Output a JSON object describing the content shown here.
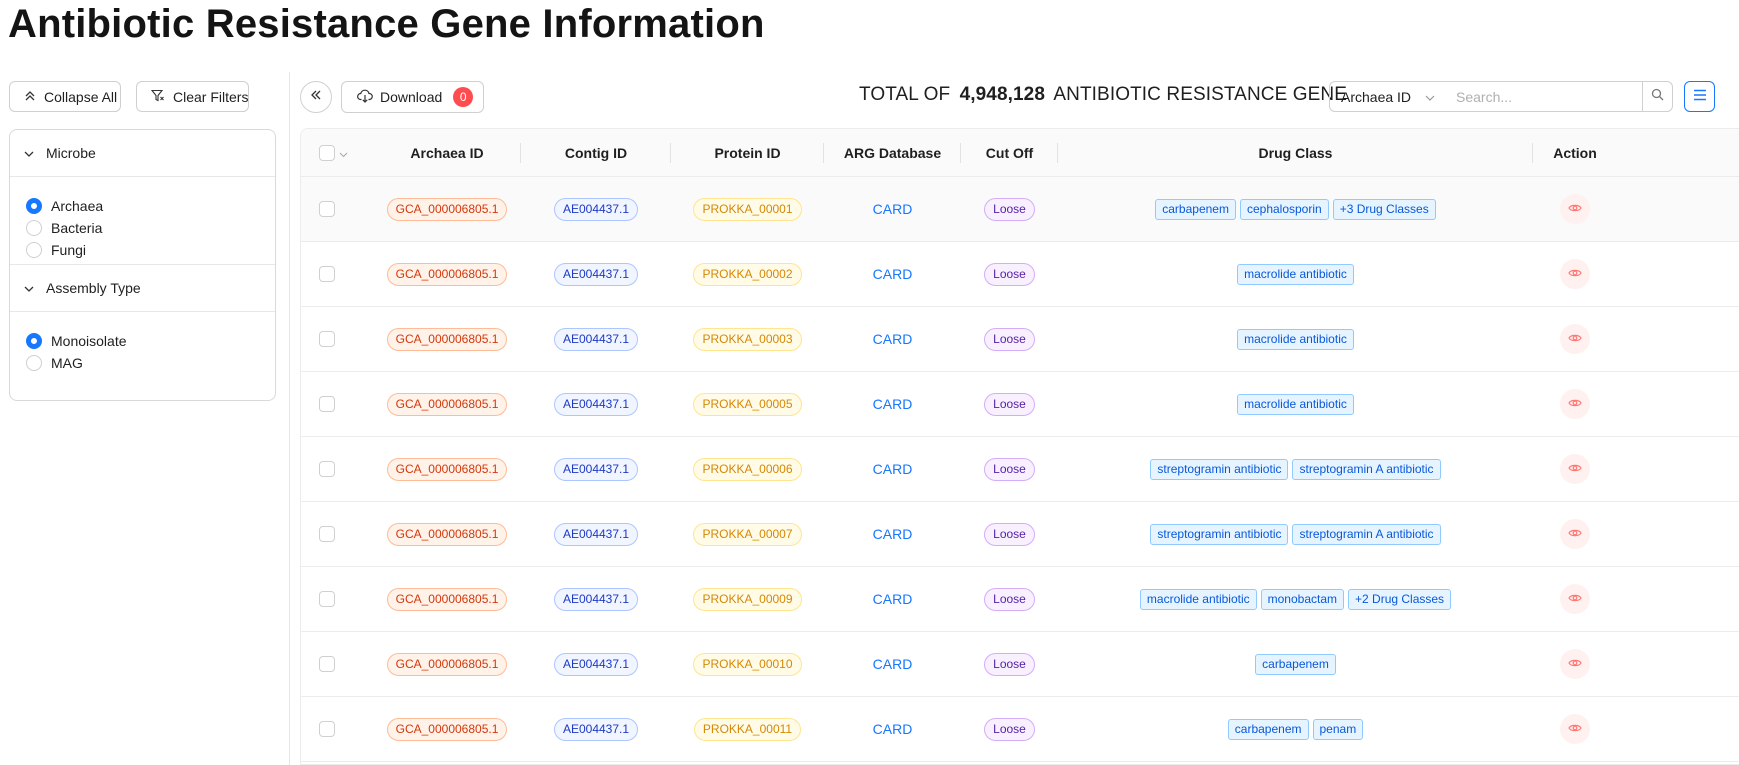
{
  "page": {
    "title": "Antibiotic Resistance Gene Information"
  },
  "left_panel": {
    "collapse_all_label": "Collapse All",
    "clear_filters_label": "Clear Filters",
    "sections": {
      "microbe": {
        "title": "Microbe",
        "options": [
          "Archaea",
          "Bacteria",
          "Fungi"
        ],
        "selected": "Archaea"
      },
      "assembly_type": {
        "title": "Assembly Type",
        "options": [
          "Monoisolate",
          "MAG"
        ],
        "selected": "Monoisolate"
      }
    }
  },
  "toolbar": {
    "download_label": "Download",
    "download_count": "0",
    "total_prefix": "TOTAL OF",
    "total_count": "4,948,128",
    "total_suffix": "ANTIBIOTIC RESISTANCE GENE",
    "search_field": "Archaea ID",
    "search_placeholder": "Search..."
  },
  "table": {
    "headers": {
      "archaea_id": "Archaea ID",
      "contig_id": "Contig ID",
      "protein_id": "Protein ID",
      "arg_database": "ARG Database",
      "cut_off": "Cut Off",
      "drug_class": "Drug Class",
      "action": "Action"
    },
    "rows": [
      {
        "archaea_id": "GCA_000006805.1",
        "contig_id": "AE004437.1",
        "protein_id": "PROKKA_00001",
        "db": "CARD",
        "cut_off": "Loose",
        "drug_classes": [
          "carbapenem",
          "cephalosporin",
          "+3 Drug Classes"
        ]
      },
      {
        "archaea_id": "GCA_000006805.1",
        "contig_id": "AE004437.1",
        "protein_id": "PROKKA_00002",
        "db": "CARD",
        "cut_off": "Loose",
        "drug_classes": [
          "macrolide antibiotic"
        ]
      },
      {
        "archaea_id": "GCA_000006805.1",
        "contig_id": "AE004437.1",
        "protein_id": "PROKKA_00003",
        "db": "CARD",
        "cut_off": "Loose",
        "drug_classes": [
          "macrolide antibiotic"
        ]
      },
      {
        "archaea_id": "GCA_000006805.1",
        "contig_id": "AE004437.1",
        "protein_id": "PROKKA_00005",
        "db": "CARD",
        "cut_off": "Loose",
        "drug_classes": [
          "macrolide antibiotic"
        ]
      },
      {
        "archaea_id": "GCA_000006805.1",
        "contig_id": "AE004437.1",
        "protein_id": "PROKKA_00006",
        "db": "CARD",
        "cut_off": "Loose",
        "drug_classes": [
          "streptogramin antibiotic",
          "streptogramin A antibiotic"
        ]
      },
      {
        "archaea_id": "GCA_000006805.1",
        "contig_id": "AE004437.1",
        "protein_id": "PROKKA_00007",
        "db": "CARD",
        "cut_off": "Loose",
        "drug_classes": [
          "streptogramin antibiotic",
          "streptogramin A antibiotic"
        ]
      },
      {
        "archaea_id": "GCA_000006805.1",
        "contig_id": "AE004437.1",
        "protein_id": "PROKKA_00009",
        "db": "CARD",
        "cut_off": "Loose",
        "drug_classes": [
          "macrolide antibiotic",
          "monobactam",
          "+2 Drug Classes"
        ]
      },
      {
        "archaea_id": "GCA_000006805.1",
        "contig_id": "AE004437.1",
        "protein_id": "PROKKA_00010",
        "db": "CARD",
        "cut_off": "Loose",
        "drug_classes": [
          "carbapenem"
        ]
      },
      {
        "archaea_id": "GCA_000006805.1",
        "contig_id": "AE004437.1",
        "protein_id": "PROKKA_00011",
        "db": "CARD",
        "cut_off": "Loose",
        "drug_classes": [
          "carbapenem",
          "penam"
        ]
      }
    ]
  },
  "colors": {
    "primary": "#1677ff",
    "badge_red": "#ff4d4f",
    "archaea_tag": "#d4380d",
    "contig_tag": "#1d39c4",
    "protein_tag": "#d48806",
    "cutoff_tag": "#531dab",
    "action_eye": "#ff7875"
  },
  "icons": {
    "collapse": "chevrons-up-icon",
    "clear_filters": "filter-clear-icon",
    "section_toggle": "chevron-down-icon",
    "sidebar_toggle": "double-chevron-left-icon",
    "download": "cloud-download-icon",
    "select_arrow": "chevron-down-icon",
    "search": "search-icon",
    "menu": "menu-icon",
    "action": "eye-icon"
  }
}
